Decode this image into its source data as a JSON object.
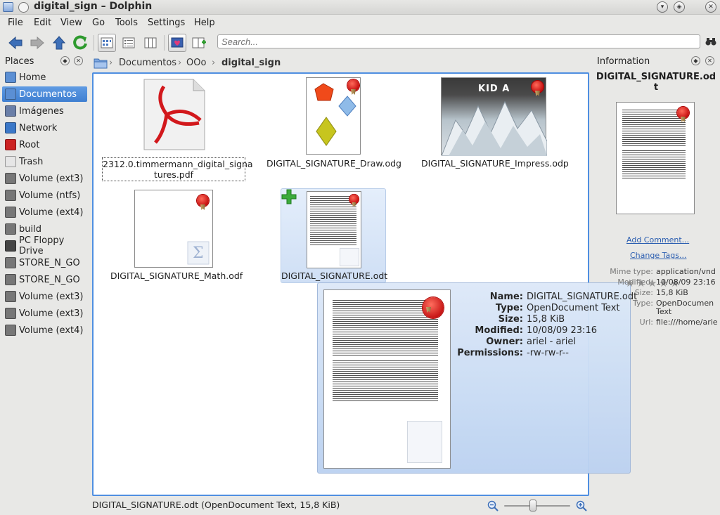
{
  "window": {
    "title": "digital_sign – Dolphin"
  },
  "menu": [
    "File",
    "Edit",
    "View",
    "Go",
    "Tools",
    "Settings",
    "Help"
  ],
  "search": {
    "placeholder": "Search..."
  },
  "places": {
    "title": "Places",
    "items": [
      {
        "label": "Home",
        "icon": "home-folder-icon",
        "color": "#5b8fd4"
      },
      {
        "label": "Documentos",
        "icon": "folder-icon",
        "color": "#5b8fd4",
        "selected": true
      },
      {
        "label": "Imágenes",
        "icon": "pictures-folder-icon",
        "color": "#6a7fa8"
      },
      {
        "label": "Network",
        "icon": "network-icon",
        "color": "#3b78c8"
      },
      {
        "label": "Root",
        "icon": "root-folder-icon",
        "color": "#cc2222"
      },
      {
        "label": "Trash",
        "icon": "trash-icon",
        "color": "#e6e6e6"
      },
      {
        "label": "Volume (ext3)",
        "icon": "drive-icon",
        "color": "#777777"
      },
      {
        "label": "Volume (ntfs)",
        "icon": "drive-icon",
        "color": "#777777"
      },
      {
        "label": "Volume (ext4)",
        "icon": "drive-icon",
        "color": "#777777"
      },
      {
        "label": "build",
        "icon": "drive-icon",
        "color": "#777777"
      },
      {
        "label": "PC Floppy Drive",
        "icon": "floppy-icon",
        "color": "#444444"
      },
      {
        "label": "STORE_N_GO",
        "icon": "usb-drive-icon",
        "color": "#777777"
      },
      {
        "label": "STORE_N_GO",
        "icon": "usb-drive-icon",
        "color": "#777777"
      },
      {
        "label": "Volume (ext3)",
        "icon": "drive-icon",
        "color": "#777777"
      },
      {
        "label": "Volume (ext3)",
        "icon": "drive-icon",
        "color": "#777777"
      },
      {
        "label": "Volume (ext4)",
        "icon": "drive-icon",
        "color": "#777777"
      }
    ]
  },
  "breadcrumb": {
    "parts": [
      "Documentos",
      "OOo",
      "digital_sign"
    ]
  },
  "files": [
    {
      "name": "2312.0.timmermann_digital_signa",
      "name2": "tures.pdf"
    },
    {
      "name": "DIGITAL_SIGNATURE_Draw.odg"
    },
    {
      "name": "DIGITAL_SIGNATURE_Impress.odp",
      "album_text": "KID A"
    },
    {
      "name": "DIGITAL_SIGNATURE_Math.odf"
    },
    {
      "name": "DIGITAL_SIGNATURE.odt"
    }
  ],
  "tooltip": {
    "rows": [
      {
        "label": "Name:",
        "value": "DIGITAL_SIGNATURE.odt"
      },
      {
        "label": "Type:",
        "value": "OpenDocument Text"
      },
      {
        "label": "Size:",
        "value": "15,8 KiB"
      },
      {
        "label": "Modified:",
        "value": "10/08/09 23:16"
      },
      {
        "label": "Owner:",
        "value": "ariel - ariel"
      },
      {
        "label": "Permissions:",
        "value": "-rw-rw-r--"
      }
    ]
  },
  "info": {
    "title": "Information",
    "filename_line1": "DIGITAL_SIGNATURE.od",
    "filename_line2": "t",
    "add_comment": "Add Comment...",
    "change_tags": "Change Tags...",
    "meta": [
      {
        "label": "Mime type:",
        "value": "application/vnd"
      },
      {
        "label": "Modified:",
        "value": "10/08/09 23:16"
      },
      {
        "label": "Size:",
        "value": "15,8 KiB"
      },
      {
        "label": "Type:",
        "value": "OpenDocumen",
        "value2": "Text"
      },
      {
        "label": "Url:",
        "value": "file:///home/arie"
      }
    ]
  },
  "status": {
    "text": "DIGITAL_SIGNATURE.odt (OpenDocument Text, 15,8 KiB)"
  }
}
